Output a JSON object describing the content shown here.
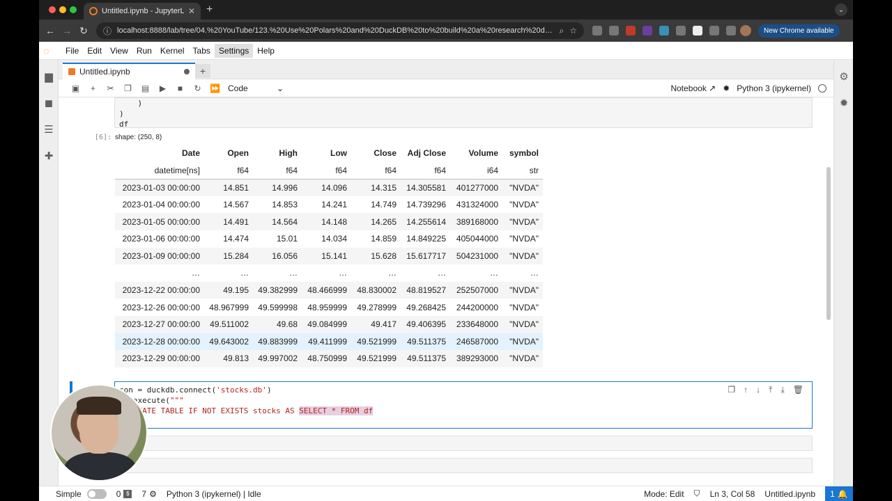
{
  "browser": {
    "tab_title": "Untitled.ipynb - JupyterLab",
    "url": "localhost:8888/lab/tree/04.%20YouTube/123.%20Use%20Polars%20and%20DuckDB%20to%20build%20a%20research%20database...",
    "update_label": "New Chrome available"
  },
  "menubar": {
    "items": [
      "File",
      "Edit",
      "View",
      "Run",
      "Kernel",
      "Tabs",
      "Settings",
      "Help"
    ]
  },
  "doc_tab": {
    "title": "Untitled.ipynb"
  },
  "nb_toolbar": {
    "cell_type": "Code",
    "notebook_label": "Notebook",
    "kernel_label": "Python 3 (ipykernel)"
  },
  "prev_cell": {
    "line1": "    )",
    "line2": ")",
    "line3": "df"
  },
  "output": {
    "prompt": "[6]:",
    "shape": "shape: (250, 8)",
    "columns": [
      "Date",
      "Open",
      "High",
      "Low",
      "Close",
      "Adj Close",
      "Volume",
      "symbol"
    ],
    "dtypes": [
      "datetime[ns]",
      "f64",
      "f64",
      "f64",
      "f64",
      "f64",
      "i64",
      "str"
    ],
    "rows": [
      [
        "2023-01-03 00:00:00",
        "14.851",
        "14.996",
        "14.096",
        "14.315",
        "14.305581",
        "401277000",
        "\"NVDA\""
      ],
      [
        "2023-01-04 00:00:00",
        "14.567",
        "14.853",
        "14.241",
        "14.749",
        "14.739296",
        "431324000",
        "\"NVDA\""
      ],
      [
        "2023-01-05 00:00:00",
        "14.491",
        "14.564",
        "14.148",
        "14.265",
        "14.255614",
        "389168000",
        "\"NVDA\""
      ],
      [
        "2023-01-06 00:00:00",
        "14.474",
        "15.01",
        "14.034",
        "14.859",
        "14.849225",
        "405044000",
        "\"NVDA\""
      ],
      [
        "2023-01-09 00:00:00",
        "15.284",
        "16.056",
        "15.141",
        "15.628",
        "15.617717",
        "504231000",
        "\"NVDA\""
      ],
      [
        "…",
        "…",
        "…",
        "…",
        "…",
        "…",
        "…",
        "…"
      ],
      [
        "2023-12-22 00:00:00",
        "49.195",
        "49.382999",
        "48.466999",
        "48.830002",
        "48.819527",
        "252507000",
        "\"NVDA\""
      ],
      [
        "2023-12-26 00:00:00",
        "48.967999",
        "49.599998",
        "48.959999",
        "49.278999",
        "49.268425",
        "244200000",
        "\"NVDA\""
      ],
      [
        "2023-12-27 00:00:00",
        "49.511002",
        "49.68",
        "49.084999",
        "49.417",
        "49.406395",
        "233648000",
        "\"NVDA\""
      ],
      [
        "2023-12-28 00:00:00",
        "49.643002",
        "49.883999",
        "49.411999",
        "49.521999",
        "49.511375",
        "246587000",
        "\"NVDA\""
      ],
      [
        "2023-12-29 00:00:00",
        "49.813",
        "49.997002",
        "48.750999",
        "49.521999",
        "49.511375",
        "389293000",
        "\"NVDA\""
      ]
    ]
  },
  "active_cell": {
    "line1_a": "con = duckdb.",
    "line1_b": "connect(",
    "line1_c": "'stocks.db'",
    "line1_d": ")",
    "line2_a": "   execute(",
    "line2_b": "\"\"\"",
    "line3_a": "   REATE TABLE IF NOT EXISTS stocks AS ",
    "line3_b": "SELECT * FROM df"
  },
  "statusbar": {
    "mode_label": "Simple",
    "count_a": "0",
    "count_b": "7",
    "kernel_status": "Python 3 (ipykernel) | Idle",
    "mode": "Mode: Edit",
    "cursor": "Ln 3, Col 58",
    "filename": "Untitled.ipynb",
    "notifications": "1"
  },
  "colors": {
    "accent": "#1976d2",
    "jupyter_orange": "#f37726",
    "highlight_row": "#e3f2fd"
  }
}
